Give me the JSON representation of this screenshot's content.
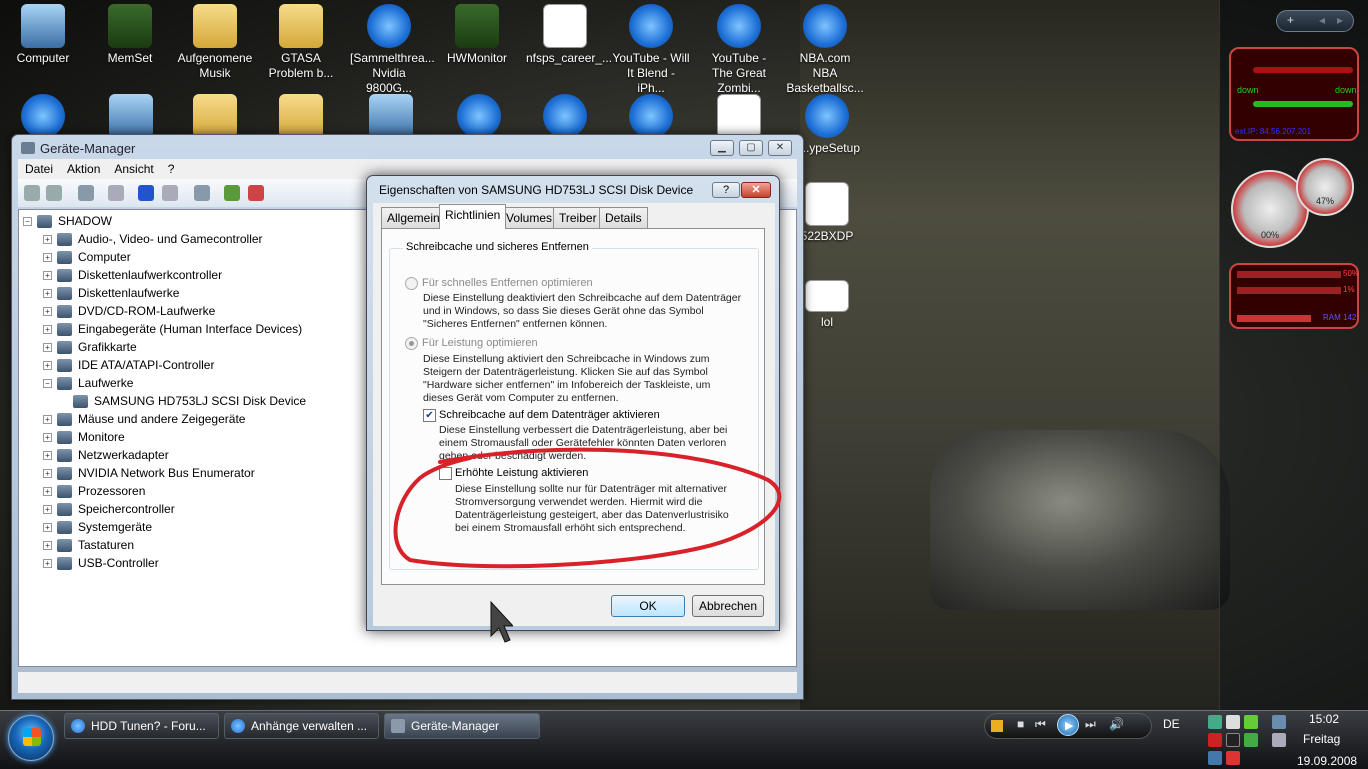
{
  "desktop": {
    "icons_row1": [
      {
        "label": "Computer",
        "kind": "pc"
      },
      {
        "label": "MemSet",
        "kind": "chip"
      },
      {
        "label": "Aufgenomene Musik",
        "kind": "folder"
      },
      {
        "label": "GTASA Problem b...",
        "kind": "folder"
      },
      {
        "label": "[Sammelthrea... Nvidia 9800G...",
        "kind": "ie"
      },
      {
        "label": "HWMonitor",
        "kind": "chip"
      },
      {
        "label": "nfsps_career_...",
        "kind": "doc"
      },
      {
        "label": "YouTube - Will It Blend - iPh...",
        "kind": "ie"
      },
      {
        "label": "YouTube - The Great Zombi...",
        "kind": "ie"
      },
      {
        "label": "NBA.com NBA Basketballsc...",
        "kind": "ie"
      }
    ],
    "icons_right": [
      {
        "label": "...ypeSetup"
      },
      {
        "label": "522BXDP"
      },
      {
        "label": "lol"
      }
    ]
  },
  "sidebar": {
    "net": {
      "down1": "down",
      "down2": "down",
      "ip": "ext.IP: 84.56.207.201"
    },
    "cpu": {
      "gauge1": "00%",
      "gauge2": "47%"
    },
    "mem": {
      "value1": "50%",
      "value2": "1%",
      "value3": "RAM 142"
    }
  },
  "devmgr": {
    "title": "Geräte-Manager",
    "menu": [
      "Datei",
      "Aktion",
      "Ansicht",
      "?"
    ],
    "root": "SHADOW",
    "tree": [
      {
        "label": "Audio-, Video- und Gamecontroller",
        "expander": "+"
      },
      {
        "label": "Computer",
        "expander": "+"
      },
      {
        "label": "Diskettenlaufwerkcontroller",
        "expander": "+"
      },
      {
        "label": "Diskettenlaufwerke",
        "expander": "+"
      },
      {
        "label": "DVD/CD-ROM-Laufwerke",
        "expander": "+"
      },
      {
        "label": "Eingabegeräte (Human Interface Devices)",
        "expander": "+"
      },
      {
        "label": "Grafikkarte",
        "expander": "+"
      },
      {
        "label": "IDE ATA/ATAPI-Controller",
        "expander": "+"
      },
      {
        "label": "Laufwerke",
        "expander": "−"
      },
      {
        "label": "SAMSUNG HD753LJ SCSI Disk Device",
        "expander": "",
        "child": true
      },
      {
        "label": "Mäuse und andere Zeigegeräte",
        "expander": "+"
      },
      {
        "label": "Monitore",
        "expander": "+"
      },
      {
        "label": "Netzwerkadapter",
        "expander": "+"
      },
      {
        "label": "NVIDIA Network Bus Enumerator",
        "expander": "+"
      },
      {
        "label": "Prozessoren",
        "expander": "+"
      },
      {
        "label": "Speichercontroller",
        "expander": "+"
      },
      {
        "label": "Systemgeräte",
        "expander": "+"
      },
      {
        "label": "Tastaturen",
        "expander": "+"
      },
      {
        "label": "USB-Controller",
        "expander": "+"
      }
    ]
  },
  "dialog": {
    "title": "Eigenschaften von SAMSUNG HD753LJ SCSI Disk Device",
    "help": "?",
    "close": "✕",
    "tabs": [
      "Allgemein",
      "Richtlinien",
      "Volumes",
      "Treiber",
      "Details"
    ],
    "active_tab": "Richtlinien",
    "group_title": "Schreibcache und sicheres Entfernen",
    "opt1_label": "Für schnelles Entfernen optimieren",
    "opt1_desc": "Diese Einstellung deaktiviert den Schreibcache auf dem Datenträger und in Windows, so dass Sie dieses Gerät ohne das Symbol \"Sicheres Entfernen\" entfernen können.",
    "opt2_label": "Für Leistung optimieren",
    "opt2_desc": "Diese Einstellung aktiviert den Schreibcache in Windows zum Steigern der Datenträgerleistung. Klicken Sie auf das Symbol \"Hardware sicher entfernen\" im Infobereich der Taskleiste, um dieses Gerät vom Computer zu entfernen.",
    "cb1_label": "Schreibcache auf dem Datenträger aktivieren",
    "cb1_checked": true,
    "cb1_desc": "Diese Einstellung verbessert die Datenträgerleistung, aber bei einem Stromausfall oder Gerätefehler könnten Daten verloren gehen oder beschädigt werden.",
    "cb2_label": "Erhöhte Leistung aktivieren",
    "cb2_checked": false,
    "cb2_desc": "Diese Einstellung sollte nur für Datenträger mit alternativer Stromversorgung verwendet werden. Hiermit wird die Datenträgerleistung gesteigert, aber das Datenverlustrisiko bei einem Stromausfall erhöht sich entsprechend.",
    "ok": "OK",
    "cancel": "Abbrechen",
    "annotation_color": "#d8222a"
  },
  "taskbar": {
    "tasks": [
      "HDD Tunen? - Foru...",
      "Anhänge verwalten ...",
      "Geräte-Manager"
    ],
    "active_task": "Geräte-Manager",
    "lang": "DE",
    "time": "15:02",
    "day": "Freitag",
    "date": "19.09.2008"
  },
  "colors": {
    "accent": "#3c7fb1",
    "close": "#c6412e"
  }
}
